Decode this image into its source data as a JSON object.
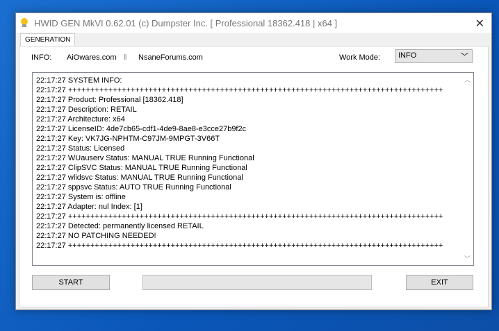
{
  "window": {
    "title": "HWID GEN MkVI 0.62.01 (c) Dumpster Inc. [ Professional 18362.418 | x64 ]",
    "close": "✕"
  },
  "tabs": [
    {
      "label": "GENERATION",
      "active": true
    }
  ],
  "info": {
    "label": "INFO:",
    "site1": "AiOwares.com",
    "separator": "‖",
    "site2": "NsaneForums.com"
  },
  "work_mode": {
    "label": "Work Mode:",
    "value": "INFO"
  },
  "log": [
    "22:17:27 SYSTEM INFO:",
    "22:17:27 ++++++++++++++++++++++++++++++++++++++++++++++++++++++++++++++++++++++++++++++++++++",
    "22:17:27 Product: Professional [18362.418]",
    "22:17:27 Description: RETAIL",
    "22:17:27 Architecture: x64",
    "22:17:27 LicenseID: 4de7cb65-cdf1-4de9-8ae8-e3cce27b9f2c",
    "22:17:27 Key: VK7JG-NPHTM-C97JM-9MPGT-3V66T",
    "22:17:27 Status: Licensed",
    "22:17:27 WUauserv Status: MANUAL TRUE Running Functional",
    "22:17:27 ClipSVC Status: MANUAL TRUE Running Functional",
    "22:17:27 wlidsvc Status: MANUAL TRUE Running Functional",
    "22:17:27 sppsvc Status: AUTO TRUE Running Functional",
    "22:17:27 System is: offline",
    "22:17:27 Adapter: nul Index: [1]",
    "22:17:27 ++++++++++++++++++++++++++++++++++++++++++++++++++++++++++++++++++++++++++++++++++++",
    "22:17:27 Detected: permanently licensed RETAIL",
    "22:17:27 NO PATCHING NEEDED!",
    "22:17:27 ++++++++++++++++++++++++++++++++++++++++++++++++++++++++++++++++++++++++++++++++++++"
  ],
  "buttons": {
    "start": "START",
    "exit": "EXIT"
  },
  "progress": 0
}
